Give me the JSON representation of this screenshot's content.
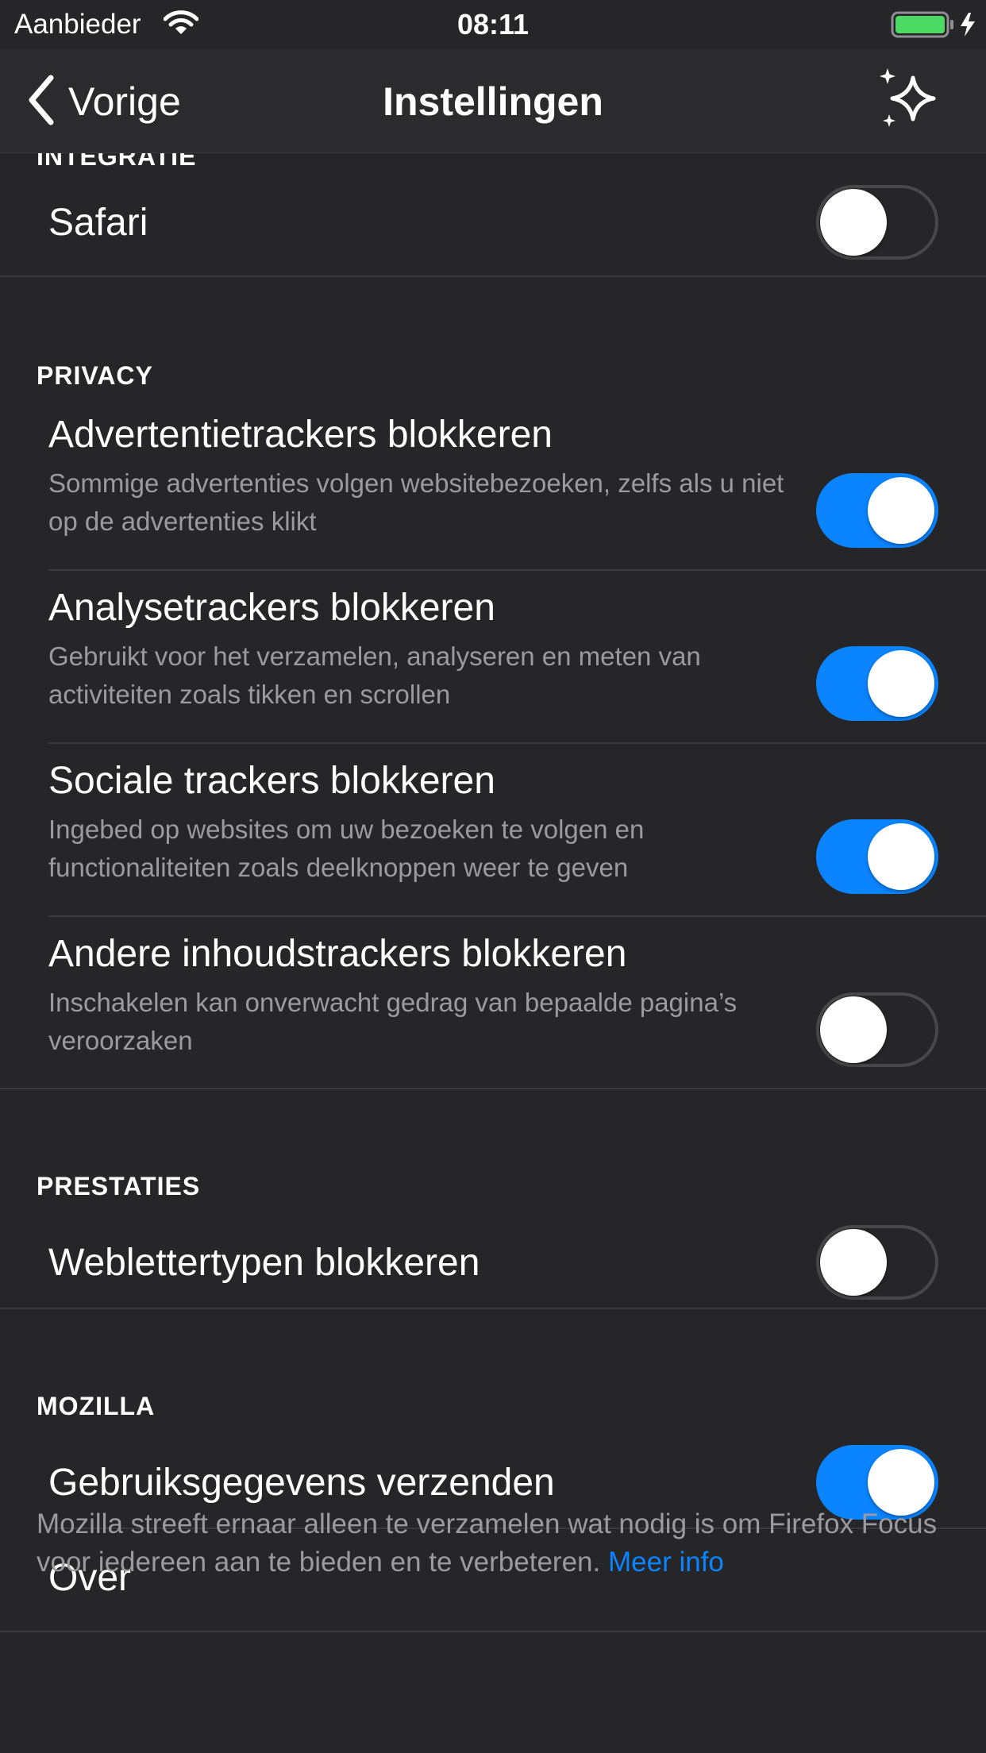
{
  "status_bar": {
    "carrier": "Aanbieder",
    "time": "08:11",
    "battery_color": "#4cd964"
  },
  "nav": {
    "back_label": "Vorige",
    "title": "Instellingen",
    "right_icon": "sparkle-icon"
  },
  "sections": {
    "integratie": {
      "header": "INTEGRATIE",
      "items": [
        {
          "title": "Safari",
          "on": false
        }
      ]
    },
    "privacy": {
      "header": "PRIVACY",
      "items": [
        {
          "title": "Advertentietrackers blokkeren",
          "subtitle": "Sommige advertenties volgen websitebezoeken, zelfs als u niet op de advertenties klikt",
          "on": true
        },
        {
          "title": "Analysetrackers blokkeren",
          "subtitle": "Gebruikt voor het verzamelen, analyseren en meten van activiteiten zoals tikken en scrollen",
          "on": true
        },
        {
          "title": "Sociale trackers blokkeren",
          "subtitle": "Ingebed op websites om uw bezoeken te volgen en functionaliteiten zoals deelknoppen weer te geven",
          "on": true
        },
        {
          "title": "Andere inhoudstrackers blokkeren",
          "subtitle": "Inschakelen kan onverwacht gedrag van bepaalde pagina’s veroorzaken",
          "on": false
        }
      ]
    },
    "prestaties": {
      "header": "PRESTATIES",
      "items": [
        {
          "title": "Weblettertypen blokkeren",
          "on": false
        }
      ]
    },
    "mozilla": {
      "header": "MOZILLA",
      "items": [
        {
          "title": "Gebruiksgegevens verzenden",
          "on": true
        },
        {
          "title": "Over"
        }
      ]
    }
  },
  "footer": {
    "text": "Mozilla streeft ernaar alleen te verzamelen wat nodig is om Firefox Focus voor iedereen aan te bieden en te verbeteren.",
    "link": "Meer info"
  },
  "colors": {
    "background": "#262628",
    "toggle_on": "#0a84ff",
    "toggle_off_border": "#48484a",
    "secondary_text": "#9b9b9f",
    "link": "#0a84ff"
  }
}
